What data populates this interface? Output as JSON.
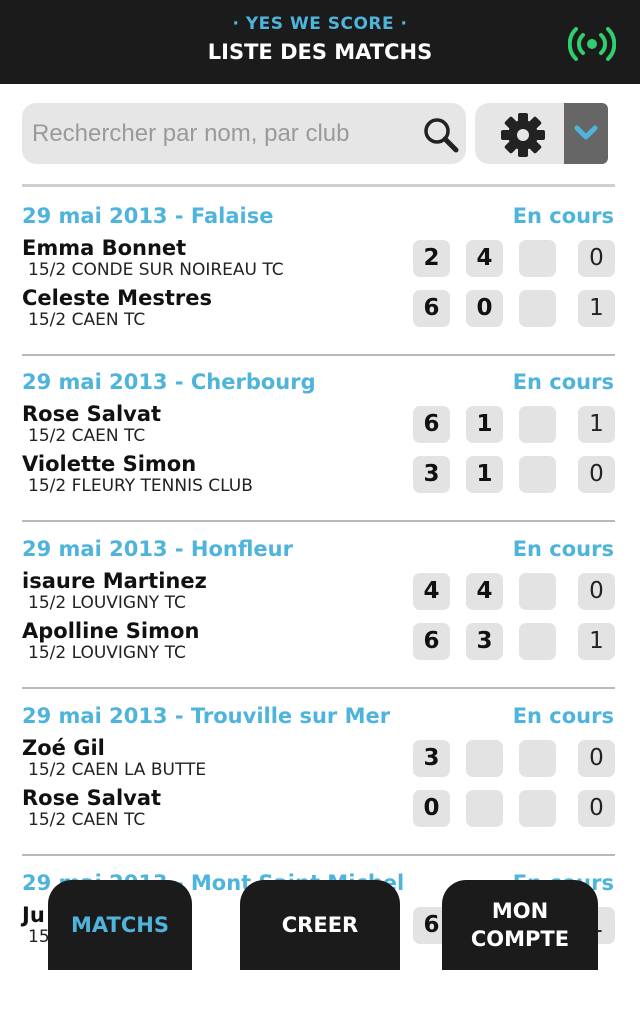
{
  "header": {
    "subtitle": "· YES WE SCORE ·",
    "title": "LISTE DES MATCHS",
    "live_icon": "broadcast-icon"
  },
  "search": {
    "placeholder": "Rechercher par nom, par club",
    "value": "",
    "search_icon": "search-icon",
    "settings_icon": "gear-icon",
    "dropdown_icon": "chevron-down-icon"
  },
  "colors": {
    "accent": "#4fb4dc",
    "dark": "#1b1b1b",
    "live_green": "#2fcf6f",
    "box": "#e3e3e3"
  },
  "matches": [
    {
      "date": "29 mai 2013 - Falaise",
      "status": "En cours",
      "players": [
        {
          "name": "Emma Bonnet",
          "club": "15/2 CONDE SUR NOIREAU TC",
          "sets": [
            "2",
            "4",
            ""
          ],
          "points": "0"
        },
        {
          "name": "Celeste Mestres",
          "club": "15/2 CAEN TC",
          "sets": [
            "6",
            "0",
            ""
          ],
          "points": "1"
        }
      ]
    },
    {
      "date": "29 mai 2013 - Cherbourg",
      "status": "En cours",
      "players": [
        {
          "name": "Rose Salvat",
          "club": "15/2 CAEN TC",
          "sets": [
            "6",
            "1",
            ""
          ],
          "points": "1"
        },
        {
          "name": "Violette Simon",
          "club": "15/2 FLEURY TENNIS CLUB",
          "sets": [
            "3",
            "1",
            ""
          ],
          "points": "0"
        }
      ]
    },
    {
      "date": "29 mai 2013 - Honfleur",
      "status": "En cours",
      "players": [
        {
          "name": "isaure Martinez",
          "club": "15/2 LOUVIGNY TC",
          "sets": [
            "4",
            "4",
            ""
          ],
          "points": "0"
        },
        {
          "name": "Apolline Simon",
          "club": "15/2 LOUVIGNY TC",
          "sets": [
            "6",
            "3",
            ""
          ],
          "points": "1"
        }
      ]
    },
    {
      "date": "29 mai 2013 - Trouville sur Mer",
      "status": "En cours",
      "players": [
        {
          "name": "Zoé Gil",
          "club": "15/2 CAEN LA BUTTE",
          "sets": [
            "3",
            "",
            ""
          ],
          "points": "0"
        },
        {
          "name": "Rose Salvat",
          "club": "15/2 CAEN TC",
          "sets": [
            "0",
            "",
            ""
          ],
          "points": "0"
        }
      ]
    },
    {
      "date": "29 mai 2013 - Mont Saint Michel",
      "status": "En cours",
      "players": [
        {
          "name": "Ju",
          "club": "15",
          "sets": [
            "6",
            "",
            ""
          ],
          "points": "1"
        }
      ]
    }
  ],
  "tabs": [
    {
      "label": "MATCHS",
      "active": true
    },
    {
      "label": "CREER",
      "active": false
    },
    {
      "label": "MON COMPTE",
      "active": false
    }
  ]
}
